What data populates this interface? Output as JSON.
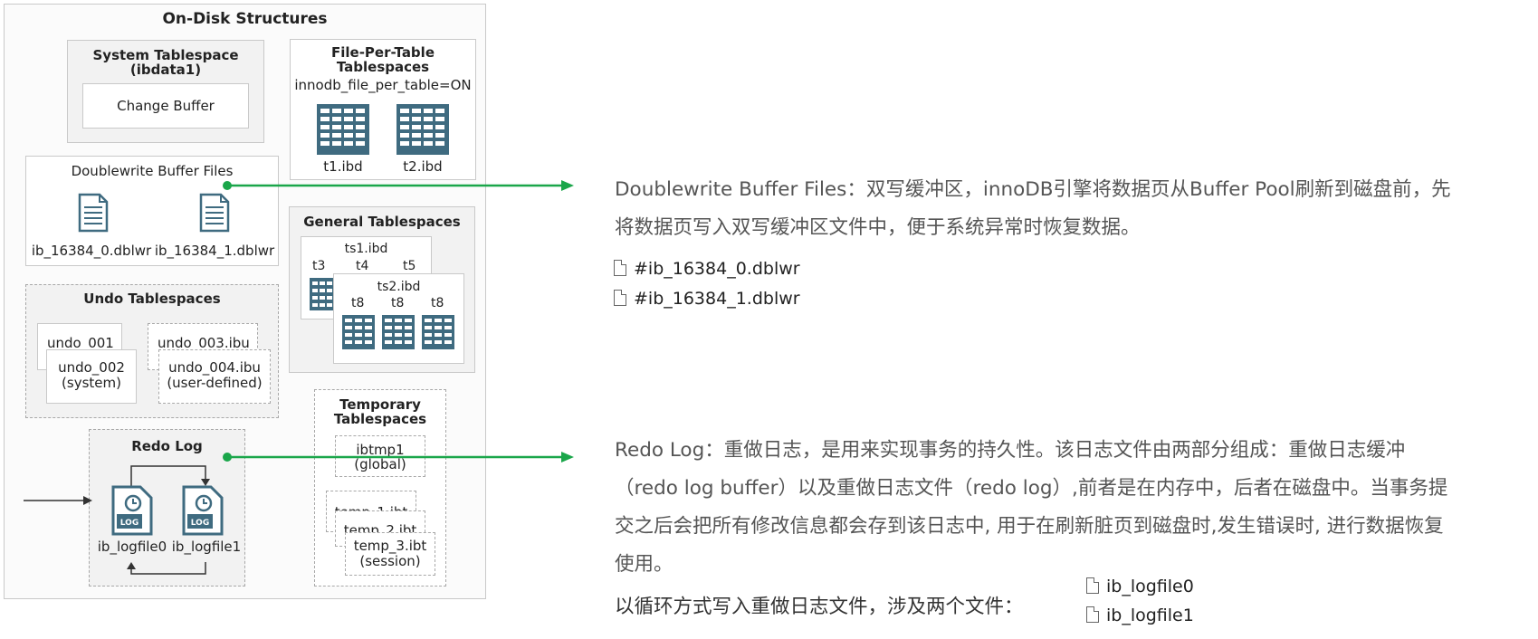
{
  "diagram": {
    "title": "On-Disk Structures",
    "system_tablespace": {
      "title_line1": "System Tablespace",
      "title_line2": "(ibdata1)",
      "change_buffer": "Change Buffer"
    },
    "file_per_table": {
      "title_line1": "File-Per-Table",
      "title_line2": "Tablespaces",
      "setting": "innodb_file_per_table=ON",
      "file1": "t1.ibd",
      "file2": "t2.ibd"
    },
    "doublewrite": {
      "title": "Doublewrite Buffer Files",
      "file1": "ib_16384_0.dblwr",
      "file2": "ib_16384_1.dblwr"
    },
    "general": {
      "title": "General Tablespaces",
      "ts1": "ts1.ibd",
      "ts1_tables": [
        "t3",
        "t4",
        "t5"
      ],
      "ts2": "ts2.ibd",
      "ts2_tables": [
        "t8",
        "t8",
        "t8"
      ]
    },
    "undo": {
      "title": "Undo Tablespaces",
      "undo1": "undo_001",
      "undo2_line1": "undo_002",
      "undo2_line2": "(system)",
      "undo3": "undo_003.ibu",
      "undo4_line1": "undo_004.ibu",
      "undo4_line2": "(user-defined)"
    },
    "temporary": {
      "title_line1": "Temporary",
      "title_line2": "Tablespaces",
      "ibtmp_line1": "ibtmp1",
      "ibtmp_line2": "(global)",
      "temp1": "temp_1.ibt",
      "temp2": "temp_2.ibt",
      "temp3_line1": "temp_3.ibt",
      "temp3_line2": "(session)"
    },
    "redo": {
      "title": "Redo Log",
      "file1": "ib_logfile0",
      "file2": "ib_logfile1",
      "log_badge": "LOG"
    }
  },
  "notes": {
    "doublewrite": {
      "line1": "Doublewrite Buffer Files：双写缓冲区，innoDB引擎将数据页从Buffer Pool刷新到磁盘前，先",
      "line2": "将数据页写入双写缓冲区文件中，便于系统异常时恢复数据。",
      "files": [
        "#ib_16384_0.dblwr",
        "#ib_16384_1.dblwr"
      ]
    },
    "redo": {
      "line1": "Redo Log：重做日志，是用来实现事务的持久性。该日志文件由两部分组成：重做日志缓冲",
      "line2": "（redo log buffer）以及重做日志文件（redo log）,前者是在内存中，后者在磁盘中。当事务提",
      "line3": "交之后会把所有修改信息都会存到该日志中, 用于在刷新脏页到磁盘时,发生错误时, 进行数据恢复",
      "line4": "使用。",
      "line5": "以循环方式写入重做日志文件，涉及两个文件：",
      "files": [
        "ib_logfile0",
        "ib_logfile1"
      ]
    }
  },
  "colors": {
    "arrow": "#1aa64a",
    "table_icon": "#3f6b80",
    "box_border": "#c9c9c9",
    "box_fill": "#f2f2f2"
  }
}
